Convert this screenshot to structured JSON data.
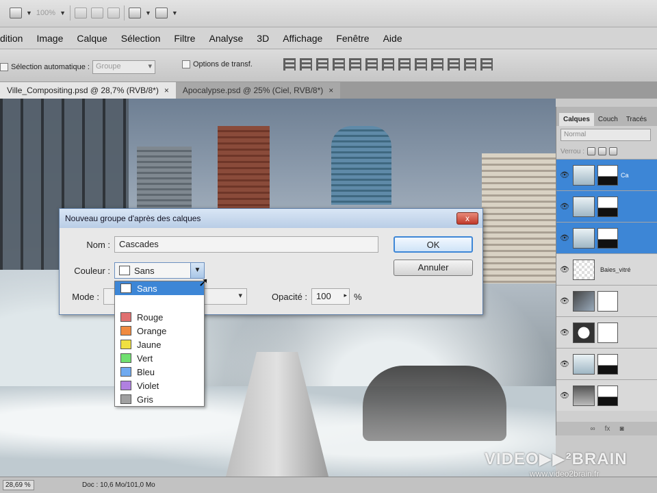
{
  "app": {
    "zoom_select": "100%"
  },
  "menu": {
    "items": [
      "dition",
      "Image",
      "Calque",
      "Sélection",
      "Filtre",
      "Analyse",
      "3D",
      "Affichage",
      "Fenêtre",
      "Aide"
    ]
  },
  "options_bar": {
    "auto_select_label": "Sélection automatique :",
    "auto_select_value": "Groupe",
    "transform_label": "Options de transf."
  },
  "tabs": [
    {
      "label": "Ville_Compositing.psd @ 28,7% (RVB/8*)",
      "close": "×"
    },
    {
      "label": "Apocalypse.psd @ 25% (Ciel, RVB/8*)",
      "close": "×"
    }
  ],
  "layers_panel": {
    "tabs": [
      "Calques",
      "Couch",
      "Tracés"
    ],
    "blend_mode": "Normal",
    "lock_label": "Verrou :",
    "layers": [
      {
        "name": "Ca",
        "selected": true
      },
      {
        "name": "",
        "selected": true
      },
      {
        "name": "",
        "selected": true
      },
      {
        "name": "Baies_vitré",
        "selected": false
      },
      {
        "name": "",
        "selected": false
      },
      {
        "name": "",
        "selected": false
      },
      {
        "name": "",
        "selected": false
      },
      {
        "name": "",
        "selected": false
      }
    ],
    "footer_fx": "fx"
  },
  "dialog": {
    "title": "Nouveau groupe d'après des calques",
    "name_label": "Nom :",
    "name_value": "Cascades",
    "color_label": "Couleur :",
    "color_value": "Sans",
    "mode_label": "Mode :",
    "opacity_label": "Opacité :",
    "opacity_value": "100",
    "opacity_unit": "%",
    "ok_label": "OK",
    "cancel_label": "Annuler",
    "close_label": "x"
  },
  "color_dropdown": {
    "items": [
      {
        "label": "Sans",
        "color": "#ffffff",
        "highlighted": true
      },
      {
        "label": "Rouge",
        "color": "#e07070",
        "highlighted": false
      },
      {
        "label": "Orange",
        "color": "#f08a40",
        "highlighted": false
      },
      {
        "label": "Jaune",
        "color": "#f0e040",
        "highlighted": false
      },
      {
        "label": "Vert",
        "color": "#70e070",
        "highlighted": false
      },
      {
        "label": "Bleu",
        "color": "#70aaf0",
        "highlighted": false
      },
      {
        "label": "Violet",
        "color": "#b080e0",
        "highlighted": false
      },
      {
        "label": "Gris",
        "color": "#a0a0a0",
        "highlighted": false
      }
    ]
  },
  "status_bar": {
    "zoom": "28,69 %",
    "doc": "Doc : 10,6 Mo/101,0 Mo"
  },
  "watermark": {
    "brand": "VIDEO▶▶²BRAIN",
    "url": "www.video2brain.fr"
  }
}
